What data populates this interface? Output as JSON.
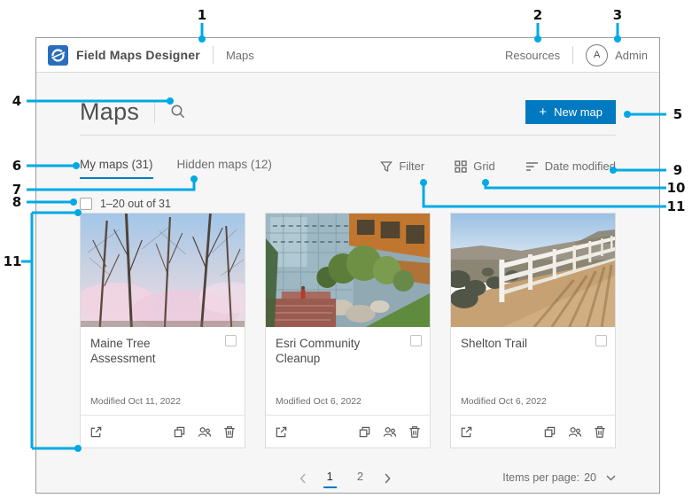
{
  "colors": {
    "accent": "#0079C1",
    "callout": "#00A9E4"
  },
  "callouts": {
    "n1": "1",
    "n2": "2",
    "n3": "3",
    "n4": "4",
    "n5": "5",
    "n6": "6",
    "n7": "7",
    "n8": "8",
    "n9": "9",
    "n10": "10",
    "n11_right": "11",
    "n11_left": "11"
  },
  "header": {
    "app_title": "Field Maps Designer",
    "nav_maps": "Maps",
    "resources": "Resources",
    "avatar_initial": "A",
    "user": "Admin"
  },
  "toolbar": {
    "title": "Maps",
    "new_map": {
      "plus": "+",
      "label": "New map"
    }
  },
  "tabs": {
    "my_maps": "My maps (31)",
    "hidden_maps": "Hidden maps (12)"
  },
  "list_controls": {
    "filter": "Filter",
    "grid": "Grid",
    "sort": "Date modified"
  },
  "selection": {
    "range": "1–20 out of 31",
    "checked": false
  },
  "cards": [
    {
      "title": "Maine Tree Assessment",
      "modified": "Modified Oct 11, 2022"
    },
    {
      "title": "Esri Community Cleanup",
      "modified": "Modified Oct 6, 2022"
    },
    {
      "title": "Shelton Trail",
      "modified": "Modified Oct 6, 2022"
    }
  ],
  "pagination": {
    "page1": "1",
    "page2": "2"
  },
  "footer": {
    "items_per_page_label": "Items per page:",
    "items_per_page_value": "20"
  },
  "icons": {
    "plus": "+",
    "chevron_left": "‹",
    "chevron_right": "›",
    "chevron_down": "⌄"
  }
}
